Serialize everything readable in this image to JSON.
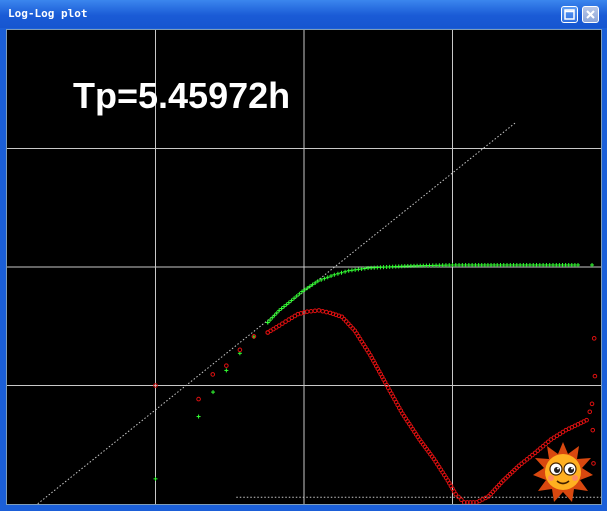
{
  "window": {
    "title": "Log-Log plot",
    "buttons": [
      {
        "name": "maximize",
        "icon": "maximize-icon"
      },
      {
        "name": "close",
        "icon": "close-icon"
      }
    ]
  },
  "annotation": {
    "text": "Tp=5.45972h"
  },
  "chart_data": {
    "type": "scatter",
    "title": "",
    "xlabel": "",
    "ylabel": "",
    "xscale": "log",
    "yscale": "log",
    "grid": true,
    "grid_color": "#c8c8c8",
    "background": "#000000",
    "xlim": [
      0.01,
      100
    ],
    "ylim": [
      0.01,
      100
    ],
    "reference_lines": [
      {
        "kind": "unit-slope",
        "style": "dotted",
        "color": "#c8c8c8",
        "points": [
          [
            0.0101,
            0.0063
          ],
          [
            26.7,
            16.6
          ]
        ]
      },
      {
        "kind": "horizontal",
        "style": "dotted",
        "color": "#c8c8c8",
        "y": 0.0114
      }
    ],
    "series": [
      {
        "kind": "pressure-change",
        "color": "#33ff33",
        "marker": "plus",
        "points": [
          [
            0.1,
            0.0163
          ],
          [
            0.195,
            0.0547
          ],
          [
            0.244,
            0.088
          ],
          [
            0.3,
            0.134
          ],
          [
            0.37,
            0.187
          ],
          [
            0.46,
            0.257
          ],
          [
            0.57,
            0.34
          ],
          [
            0.68,
            0.43
          ],
          [
            0.79,
            0.5
          ],
          [
            0.97,
            0.62
          ],
          [
            1.24,
            0.76
          ],
          [
            1.6,
            0.86
          ],
          [
            2.0,
            0.93
          ],
          [
            2.7,
            0.98
          ],
          [
            3.6,
            1.0
          ],
          [
            5.0,
            1.02
          ],
          [
            7.0,
            1.03
          ],
          [
            10.0,
            1.04
          ],
          [
            15.0,
            1.04
          ],
          [
            20.0,
            1.04
          ],
          [
            30.0,
            1.04
          ],
          [
            50.0,
            1.04
          ],
          [
            70.0,
            1.04
          ],
          [
            87.0,
            1.04
          ]
        ]
      },
      {
        "kind": "pressure-derivative",
        "color": "#e01010",
        "marker": "circle",
        "points": [
          [
            0.1,
            0.1
          ],
          [
            0.195,
            0.0768
          ],
          [
            0.243,
            0.124
          ],
          [
            0.3,
            0.147
          ],
          [
            0.37,
            0.2
          ],
          [
            0.46,
            0.26
          ],
          [
            0.57,
            0.28
          ],
          [
            0.68,
            0.32
          ],
          [
            0.79,
            0.36
          ],
          [
            0.91,
            0.4
          ],
          [
            1.05,
            0.42
          ],
          [
            1.26,
            0.43
          ],
          [
            1.5,
            0.41
          ],
          [
            1.8,
            0.38
          ],
          [
            2.2,
            0.29
          ],
          [
            2.8,
            0.18
          ],
          [
            3.6,
            0.101
          ],
          [
            4.6,
            0.058
          ],
          [
            6.0,
            0.035
          ],
          [
            7.5,
            0.024
          ],
          [
            9.3,
            0.0158
          ],
          [
            10.5,
            0.0121
          ],
          [
            12.0,
            0.0103
          ],
          [
            14.5,
            0.0103
          ],
          [
            17.5,
            0.0116
          ],
          [
            22.0,
            0.0158
          ],
          [
            28.0,
            0.021
          ],
          [
            36.0,
            0.027
          ],
          [
            46.0,
            0.035
          ],
          [
            58.0,
            0.042
          ],
          [
            70.0,
            0.047
          ],
          [
            80.0,
            0.051
          ],
          [
            84.0,
            0.06
          ],
          [
            87.0,
            0.07
          ],
          [
            88.0,
            0.042
          ],
          [
            89.0,
            0.022
          ],
          [
            90.0,
            0.25
          ],
          [
            91.0,
            0.12
          ]
        ]
      }
    ]
  },
  "overlay": {
    "icon": "sun-mascot-icon"
  }
}
